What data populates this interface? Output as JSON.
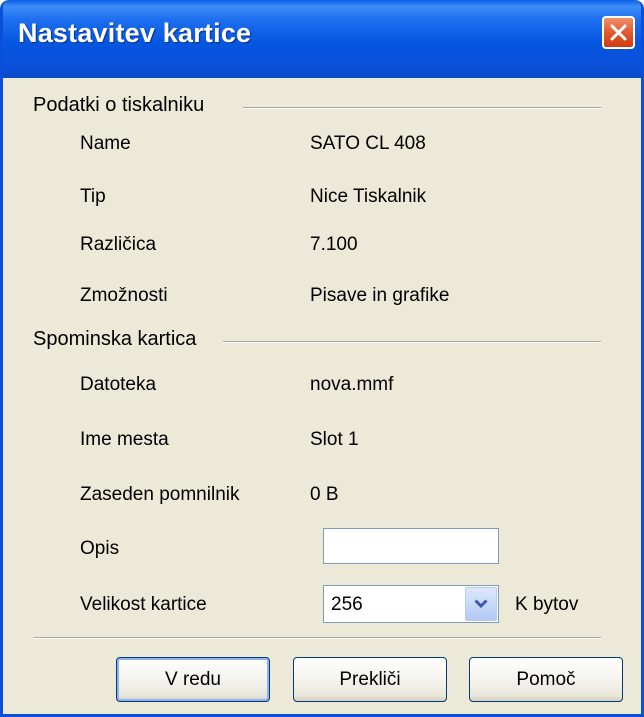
{
  "window": {
    "title": "Nastavitev kartice"
  },
  "printer_group": {
    "title": "Podatki o tiskalniku",
    "rows": [
      {
        "label": "Name",
        "value": "SATO CL 408"
      },
      {
        "label": "Tip",
        "value": "Nice Tiskalnik"
      },
      {
        "label": "Različica",
        "value": "7.100"
      },
      {
        "label": "Zmožnosti",
        "value": "Pisave in grafike"
      }
    ]
  },
  "card_group": {
    "title": "Spominska kartica",
    "rows": [
      {
        "label": "Datoteka",
        "value": "nova.mmf"
      },
      {
        "label": "Ime mesta",
        "value": "Slot 1"
      },
      {
        "label": "Zaseden pomnilnik",
        "value": "0 B"
      }
    ],
    "description_label": "Opis",
    "description_value": "",
    "size_label": "Velikost kartice",
    "size_value": "256",
    "size_unit": "K bytov"
  },
  "buttons": {
    "ok": "V redu",
    "cancel": "Prekliči",
    "help": "Pomoč"
  }
}
